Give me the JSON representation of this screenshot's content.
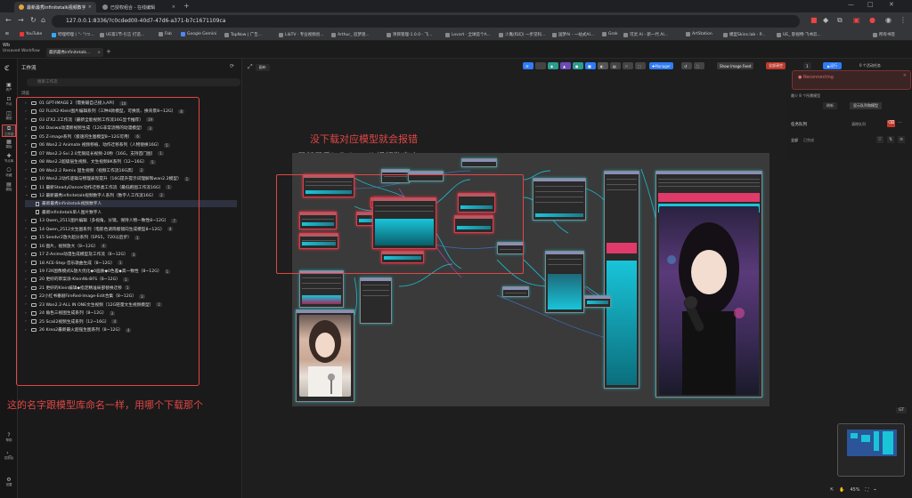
{
  "browser": {
    "tabs": [
      {
        "title": "最新最秀infinitetalk视频数字..."
      },
      {
        "title": "已授权组合 - 在线编辑"
      }
    ],
    "url": "127.0.0.1:8336/?c0cded00-40d7-47d6-a371-b7c1671109ca",
    "bookmarks": [
      "YouTube",
      "哔哩哔哩 ( °- °)つ...",
      "UE第1节·引言 打造...",
      "Fab",
      "Google Gemini",
      "TapNow | 广告...",
      "LibTV · 专业视频创...",
      "Arthur_ 追梦逐...",
      "项目管理-1.0.0 - 飞...",
      "Lovart · 全球首个A...",
      "少胤(科幻) 一步见科...",
      "国梦AI - 一站式AI...",
      "Grok",
      "可灵 AI - 新一代 AI...",
      "ArtStation",
      "模型Skins.lab - P...",
      "UE_ 影视特-飞书云..."
    ],
    "all_bookmarks": "所有书签"
  },
  "app": {
    "logo_text": "Wb",
    "unsaved_tab": "Unsaved Workflow",
    "active_workflow_tab": "最新最秀infinitetalk..."
  },
  "rail": [
    {
      "label": "资产"
    },
    {
      "label": "节点"
    },
    {
      "label": "模型"
    },
    {
      "label": "工作流"
    },
    {
      "label": "模板"
    },
    {
      "label": "节点库"
    },
    {
      "label": "收藏"
    },
    {
      "label": "模板"
    }
  ],
  "rail_bottom": [
    {
      "label": "帮助"
    },
    {
      "label": "控制台"
    },
    {
      "label": "设置"
    }
  ],
  "panel": {
    "title": "工作流",
    "search_placeholder": "搜索工作流",
    "section": "浏览",
    "items": [
      {
        "label": "01 GPT-IMAGE 2（需要输自己接入API）",
        "count": "10",
        "open": false
      },
      {
        "label": "02 FLUX2-Klein图片编辑系列（三种4款模型，可换装、换背景8~12G）",
        "count": "8",
        "open": false
      },
      {
        "label": "03 LTX2.3工作流（最新全能视频工作流16G显卡推荐）",
        "count": "19",
        "open": false
      },
      {
        "label": "04 Dasiwa动漫新视频生成（12G非常流畅的动漫模型）",
        "count": "3",
        "open": false
      },
      {
        "label": "05 Z-image系列（极速的生图模型8~12G可用）",
        "count": "6",
        "open": false
      },
      {
        "label": "06 Wan2.2 Animate 视频移植、动作迁移系列（人物替换16G）",
        "count": "5",
        "open": false
      },
      {
        "label": "07 Wan2.2-Svi 2.0无限延长视频-20秒（16G，支持首门图）",
        "count": "1",
        "open": false
      },
      {
        "label": "08 Wan2.2超级层生视频、文生视频8K系列（12~16G）",
        "count": "5",
        "open": false
      },
      {
        "label": "09 Wan2.2 Remix 固生视频（视频工作流16G高）",
        "count": "2",
        "open": false
      },
      {
        "label": "10 Wan2.2动作逻辑与物理表现提升（16G提升提示词理解和wan2.2模型）",
        "count": "1",
        "open": false
      },
      {
        "label": "11 最新SteadyDancer动作迁移类工作流（最低跑图工作流16G）",
        "count": "1",
        "open": false
      },
      {
        "label": "12 最新最秀infinitetalk视频数字人系列（数字人工作流16G）",
        "count": "2",
        "open": true
      }
    ],
    "children": [
      {
        "label": "最新最秀infinitetalk视频数字人"
      },
      {
        "label": "最新infinitetalk单人图片数字人"
      }
    ],
    "items2": [
      {
        "label": "13 Qwen_2511图片编辑（多视角，分镜，保持人物一致性8~12G）",
        "count": "7"
      },
      {
        "label": "14 Qwen_2512文生图系列（电影色调简版镜向生成模型8~12G）",
        "count": "4"
      },
      {
        "label": "15 Seedvr2放大超分系列（SPS5，720以后步）",
        "count": "1"
      },
      {
        "label": "16 图片，视频放大（8~12G）",
        "count": "4"
      },
      {
        "label": "17 Z-Anime动漫生成模型及工作流（8~12G）",
        "count": "3"
      },
      {
        "label": "18 ACE-Step-音乐歌曲生成（8~12G）",
        "count": "1"
      },
      {
        "label": "19 F2K图像模式&放大优化◆0画质◆0色差◆高一致性（8~12G）",
        "count": "1"
      },
      {
        "label": "20 更好的草案派-Klein9b-BFS（8~12G）",
        "count": "1"
      },
      {
        "label": "21 更好的Klein编辑◆指定精准局部替换迁移",
        "count": "1"
      },
      {
        "label": "22小红书番剧FireRed-Image-Edit合集（8~12G）",
        "count": "3"
      },
      {
        "label": "23 Wan2.2-ALL IN ONE文生视频（12G轻量文生视频模型）",
        "count": "1"
      },
      {
        "label": "24 角色三视图生成系列（8~12G）",
        "count": "3"
      },
      {
        "label": "25 Scail2视频生成系列（12~16G）",
        "count": "4"
      },
      {
        "label": "26 Krea2最新最火超强生图系列（8~12G）",
        "count": "4"
      }
    ],
    "annotation": "这的名字跟模型库命名一样，用哪个下载那个"
  },
  "canvas": {
    "annotation_top": "没下载对应模型就会报错",
    "group_title": "最新最秀infinitetalk视频数字人",
    "toolbar": {
      "manager": "Manager",
      "show_image_feed": "Show Image Feed",
      "stop": "全部清空",
      "queue_count": "1",
      "run": "运行",
      "queue_label": "0 个活动任务"
    },
    "toast": "Reconnecting",
    "right_panel": {
      "dropdown": "最少 8 个所需模型",
      "btn1": "刷新",
      "btn2": "显示队列和模型",
      "queue_title": "任务队列",
      "clear": "清除队列",
      "tab_all": "全部",
      "tab_done": "已完成"
    },
    "zoom": "45%",
    "mode_button": "画布"
  },
  "colors": {
    "accent_blue": "#2f7cf6",
    "annotation_red": "#e04646",
    "node_cyan": "#19c4d9"
  }
}
